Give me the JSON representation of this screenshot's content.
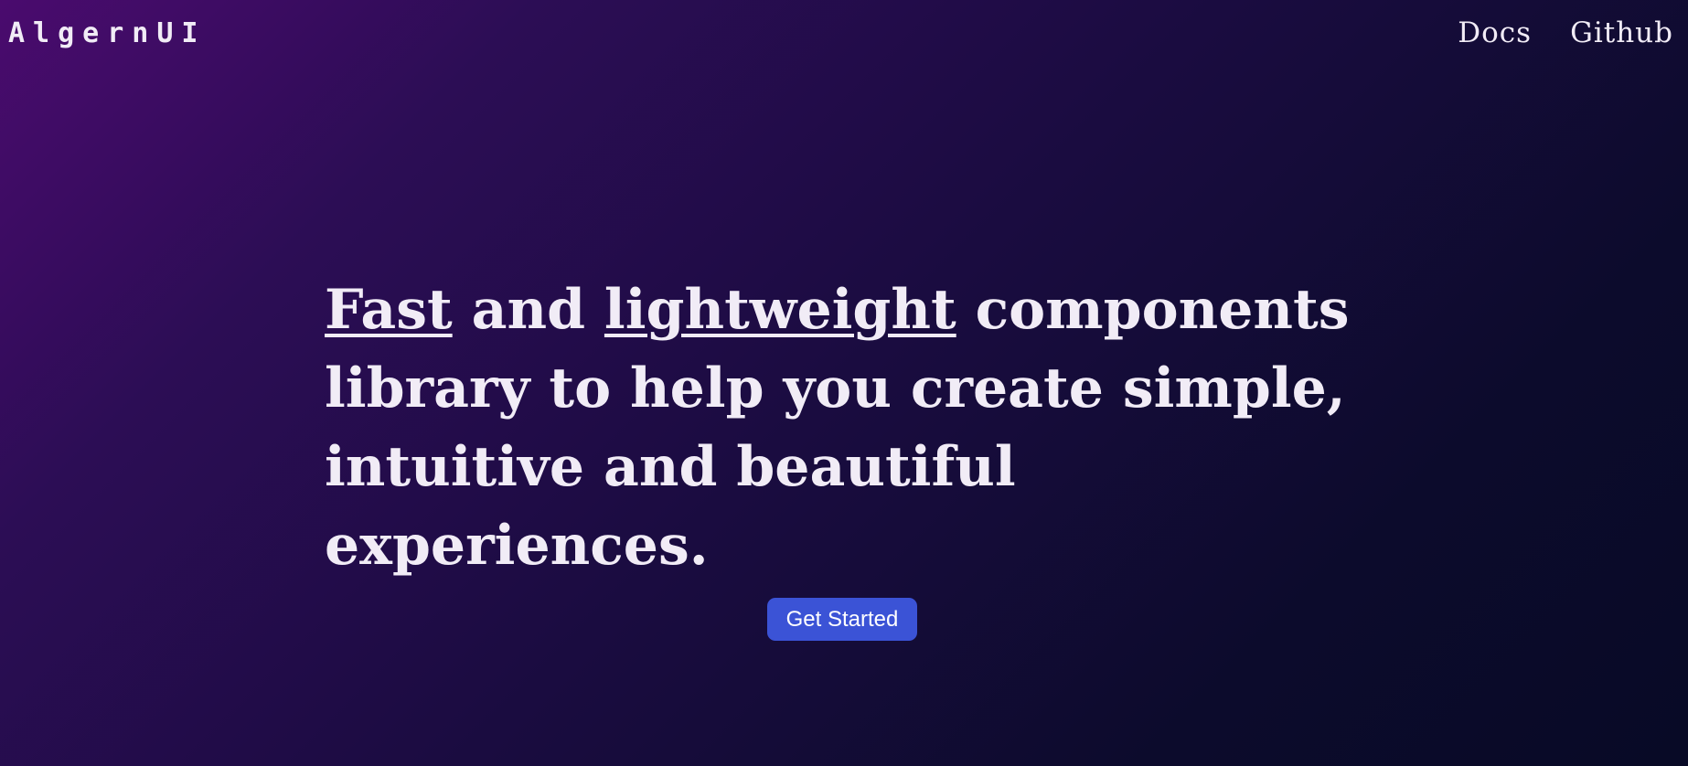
{
  "brand": {
    "logo": "AlgernUI"
  },
  "nav": {
    "items": [
      {
        "label": "Docs"
      },
      {
        "label": "Github"
      }
    ]
  },
  "hero": {
    "word_fast": "Fast",
    "text_and": " and ",
    "word_lightweight": "lightweight",
    "text_rest": " components library to help you create simple, intuitive and beautiful experiences."
  },
  "cta": {
    "label": "Get Started"
  },
  "colors": {
    "background_start": "#4a0b6e",
    "background_end": "#080a26",
    "text": "#f1ecf6",
    "button": "#3b53d6"
  }
}
